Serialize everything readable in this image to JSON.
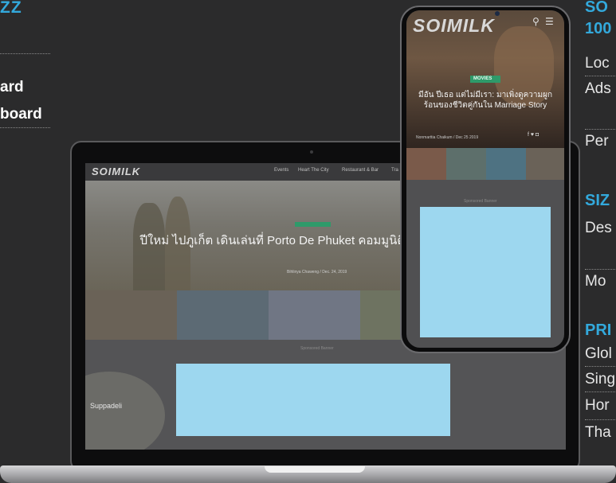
{
  "left_panel": {
    "title_fragment": "ZZ",
    "item1_fragment": "ard",
    "item2_fragment": "board"
  },
  "right_panel": {
    "head1_line1": "SO",
    "head1_line2": "100",
    "item_local": "Loc",
    "item_ads": "Ads",
    "item_per": "Per",
    "head_size": "SIZ",
    "item_desktop": "Des",
    "item_mobile": "Mo",
    "head_price": "PRI",
    "item_global": "Glol",
    "item_single": "Sing",
    "item_home": "Hor",
    "item_thai": "Tha"
  },
  "laptop_site": {
    "logo": "SOIMILK",
    "menu": [
      "Events",
      "Heart The City",
      "Restaurant & Bar",
      "Tra"
    ],
    "headline": "ปีใหม่ ไปภูเก็ต เดินเล่นที่ Porto De Phuket คอมมูนิตี้ หญ้าของชุมชน",
    "meta": "Bihlinya Chaweng / Dec. 24, 2019",
    "sponsor": "Sponsored Banner",
    "food_label": "Suppadeli",
    "colors": {
      "ad_placeholder": "#9dd7ef",
      "badge": "#2e9a6a"
    }
  },
  "phone_site": {
    "logo": "SOIMILK",
    "icons": [
      "search-icon",
      "hamburger-menu-icon"
    ],
    "category": "MOVIES",
    "headline": "มีอัน ปีเธอ แต่ไม่มีเรา: มาเพิ่งดูความผูกร้อนของชีวิตคู่กันใน Marriage Story",
    "meta": "Nonmarttia Chaikum / Dec 25 2019",
    "social": "f ♥ ◘",
    "sponsor": "Sponsored Banner",
    "colors": {
      "ad_placeholder": "#9dd7ef"
    }
  }
}
